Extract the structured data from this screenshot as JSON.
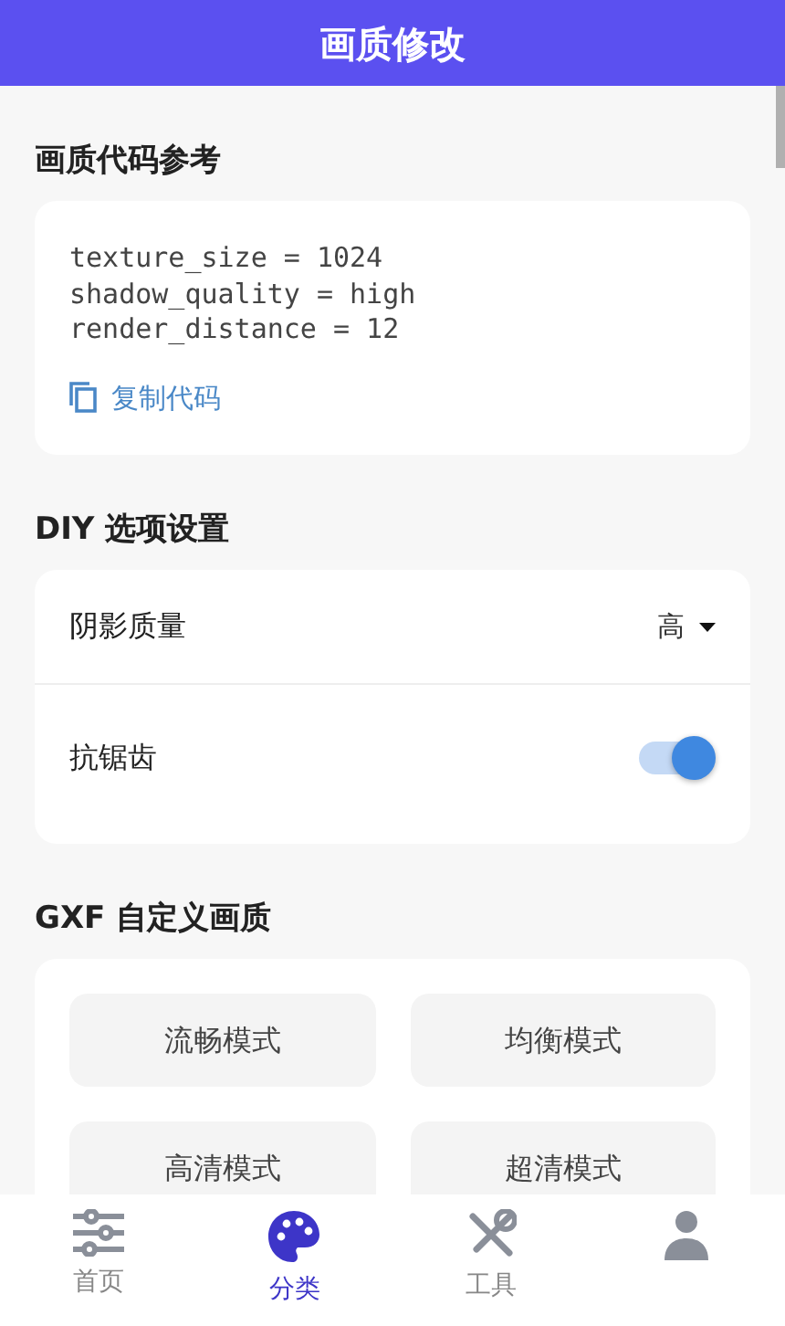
{
  "header": {
    "title": "画质修改"
  },
  "code_section": {
    "title": "画质代码参考",
    "code_lines": [
      "texture_size = 1024",
      "shadow_quality = high",
      "render_distance = 12"
    ],
    "copy_label": "复制代码"
  },
  "diy_section": {
    "title": "DIY 选项设置",
    "options": [
      {
        "kind": "select",
        "label": "阴影质量",
        "value": "高"
      },
      {
        "kind": "toggle",
        "label": "抗锯齿",
        "on": true
      }
    ]
  },
  "gxf_section": {
    "title": "GXF 自定义画质",
    "modes": [
      "流畅模式",
      "均衡模式",
      "高清模式",
      "超清模式"
    ]
  },
  "bottom_nav": [
    {
      "label": "首页",
      "selected": false
    },
    {
      "label": "分类",
      "selected": true
    },
    {
      "label": "工具",
      "selected": false
    },
    {
      "selected": false
    }
  ]
}
